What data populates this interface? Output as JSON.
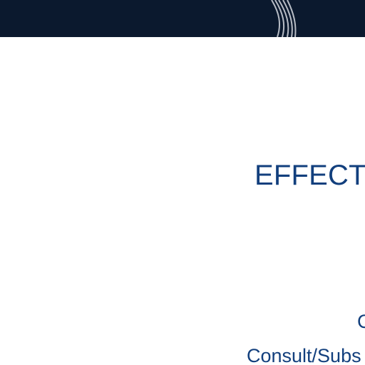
{
  "slide": {
    "title": "EFFECT",
    "line_1": "C",
    "line_2": "Consult/Subs"
  },
  "colors": {
    "header_background": "#0b192e",
    "text": "#123f7d",
    "graphic_lines": "#b7bcc5",
    "page_background": "#ffffff"
  },
  "icons": {
    "header_graphic": "curved-lines-graphic"
  }
}
